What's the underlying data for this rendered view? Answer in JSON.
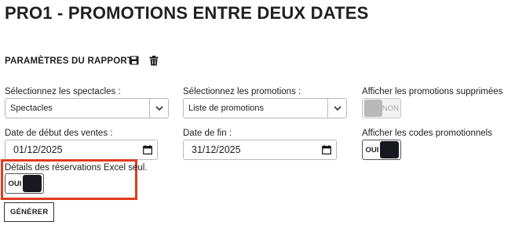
{
  "page": {
    "title": "PRO1 - PROMOTIONS ENTRE DEUX DATES"
  },
  "section": {
    "title": "PARAMÈTRES DU RAPPORT",
    "icons": [
      "save-icon",
      "delete-icon"
    ]
  },
  "filters": {
    "spectacles": {
      "label": "Sélectionnez les spectacles :",
      "value": "Spectacles"
    },
    "promotions": {
      "label": "Sélectionnez les promotions :",
      "value": "Liste de promotions"
    },
    "show_deleted": {
      "label": "Afficher les promotions supprimées",
      "state": "NON"
    },
    "start_date": {
      "label": "Date de début des ventes :",
      "value": "01/12/2025"
    },
    "end_date": {
      "label": "Date de fin :",
      "value": "31/12/2025"
    },
    "show_codes": {
      "label": "Afficher les codes promotionnels",
      "state": "OUI"
    },
    "excel_details": {
      "label": "Détails des réservations Excel seul.",
      "state": "OUI"
    }
  },
  "actions": {
    "generate_label": "GÉNÉRER"
  },
  "colors": {
    "highlight": "#e23b1f",
    "toggle_on": "#16171f",
    "toggle_off": "#b9b9b9"
  }
}
